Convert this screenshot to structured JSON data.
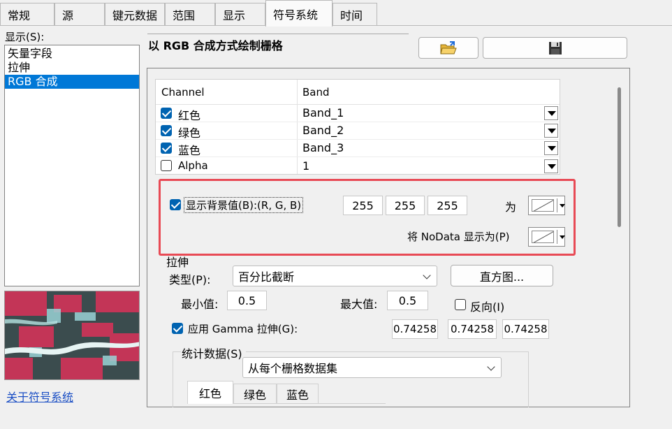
{
  "tabs": [
    "常规",
    "源",
    "键元数据",
    "范围",
    "显示",
    "符号系统",
    "时间"
  ],
  "active_tab": "符号系统",
  "left": {
    "show_label": "显示(S):",
    "items": [
      "矢量字段",
      "拉伸",
      "RGB 合成"
    ],
    "selected": "RGB 合成",
    "link": "关于符号系统"
  },
  "header": {
    "title": "以 RGB 合成方式绘制栅格"
  },
  "toolbar": {
    "open_icon": "folder-open-icon",
    "save_icon": "save-disk-icon"
  },
  "grid": {
    "col_channel": "Channel",
    "col_band": "Band",
    "rows": [
      {
        "channel": "红色",
        "band": "Band_1",
        "checked": true
      },
      {
        "channel": "绿色",
        "band": "Band_2",
        "checked": true
      },
      {
        "channel": "蓝色",
        "band": "Band_3",
        "checked": true
      },
      {
        "channel": "Alpha",
        "band": "1",
        "checked": false
      }
    ]
  },
  "background": {
    "label": "显示背景值(B):(R, G, B)",
    "checked": true,
    "r": "255",
    "g": "255",
    "b": "255",
    "as_label": "为",
    "nodata_label": "将 NoData 显示为(P)"
  },
  "stretch": {
    "group_label": "拉伸",
    "type_label": "类型(P):",
    "type_value": "百分比截断",
    "histogram_button": "直方图...",
    "min_label": "最小值:",
    "min_value": "0.5",
    "max_label": "最大值:",
    "max_value": "0.5",
    "invert_label": "反向(I)",
    "invert_checked": false,
    "gamma_label": "应用 Gamma 拉伸(G):",
    "gamma_checked": true,
    "gamma_values": [
      "0.74258",
      "0.74258",
      "0.74258"
    ],
    "stats_label": "统计数据(S)",
    "stats_value": "从每个栅格数据集",
    "subtabs": [
      "红色",
      "绿色",
      "蓝色"
    ]
  },
  "colors": {
    "selection": "#0078d7",
    "checkbox": "#0063b1",
    "highlight_border": "#e84a55",
    "link": "#1a4ec4"
  }
}
